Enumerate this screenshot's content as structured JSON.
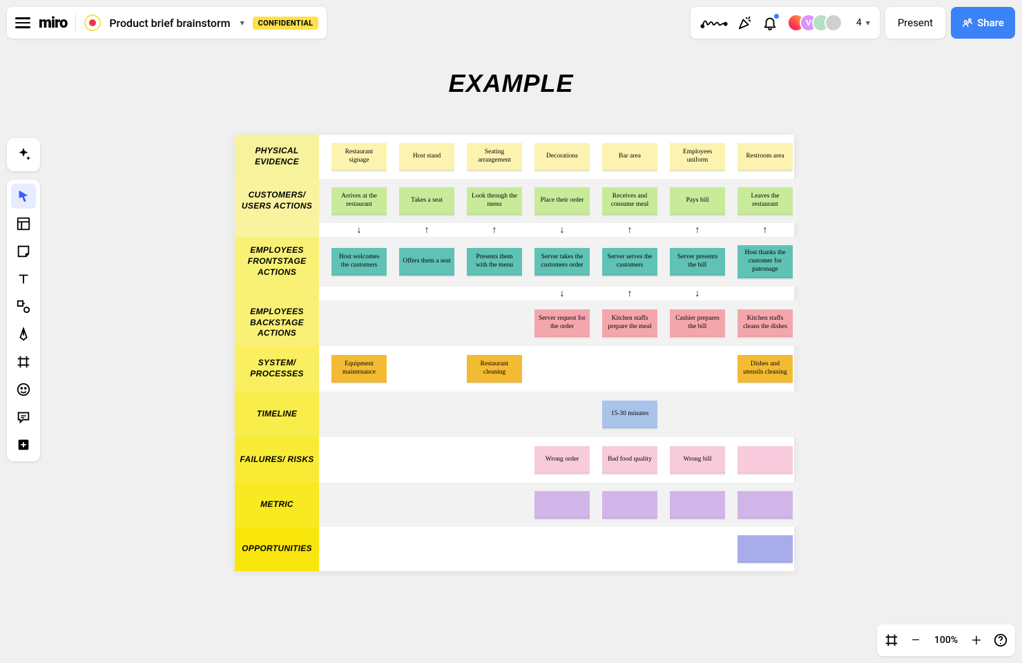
{
  "header": {
    "logo": "miro",
    "boardName": "Product brief brainstorm",
    "confidential": "CONFIDENTIAL",
    "present": "Present",
    "share": "Share",
    "collabCount": "4",
    "avatar2Initial": "V"
  },
  "footer": {
    "zoom": "100%"
  },
  "canvas": {
    "title": "EXAMPLE",
    "rows": [
      {
        "label": "PHYSICAL EVIDENCE",
        "color": "yellow",
        "notes": [
          "Restaurant signage",
          "Host stand",
          "Seating arrangement",
          "Decorations",
          "Bar area",
          "Employees uniform",
          "Restroom area"
        ]
      },
      {
        "label": "CUSTOMERS/ USERS ACTIONS",
        "color": "green",
        "notes": [
          "Arrives at the restaurant",
          "Takes a seat",
          "Look through the menu",
          "Place their order",
          "Receives and consume meal",
          "Pays bill",
          "Leaves the restaurant"
        ],
        "arrows": [
          "down",
          "up",
          "up",
          "down",
          "up",
          "up",
          "up"
        ]
      },
      {
        "label": "EMPLOYEES FRONTSTAGE ACTIONS",
        "color": "teal",
        "notes": [
          "Host welcomes the customers",
          "Offers them a seat",
          "Presents them with the menu",
          "Server takes the customers order",
          "Server serves the customers",
          "Server presents the bill",
          "Host thanks the customer for patronage"
        ],
        "arrows": [
          "",
          "",
          "",
          "down",
          "up",
          "down",
          ""
        ]
      },
      {
        "label": "EMPLOYEES BACKSTAGE ACTIONS",
        "color": "pink",
        "notes": [
          "",
          "",
          "",
          "Server request for the order",
          "Kitchen staffs prepare the meal",
          "Cashier prepares the bill",
          "Kitchen staffs cleans the dishes"
        ]
      },
      {
        "label": "SYSTEM/ PROCESSES",
        "color": "amber",
        "notes": [
          "Equipment maintenance",
          "",
          "Restaurant cleaning",
          "",
          "",
          "",
          "Dishes and utensils cleaning"
        ]
      },
      {
        "label": "TIMELINE",
        "color": "blue",
        "notes": [
          "",
          "",
          "",
          "",
          "15-30 minutes",
          "",
          ""
        ]
      },
      {
        "label": "FAILURES/ RISKS",
        "color": "rose",
        "notes": [
          "",
          "",
          "",
          "Wrong order",
          "Bad food quality",
          "Wrong bill",
          ""
        ],
        "extraBlank7": true
      },
      {
        "label": "METRIC",
        "color": "purple",
        "notes": [
          "",
          "",
          "",
          "",
          "",
          "",
          ""
        ],
        "blanks": [
          3,
          4,
          5,
          6
        ]
      },
      {
        "label": "OPPORTUNITIES",
        "color": "indigo",
        "notes": [
          "",
          "",
          "",
          "",
          "",
          "",
          ""
        ],
        "blanks": [
          6
        ]
      }
    ]
  }
}
